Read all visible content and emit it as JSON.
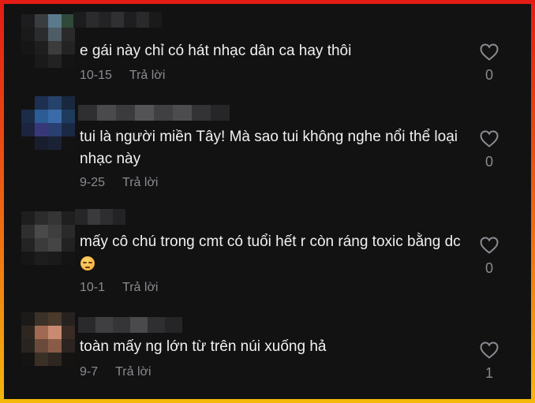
{
  "comments": [
    {
      "text": "e gái này chỉ có hát nhạc dân ca hay thôi",
      "date": "10-15",
      "reply_label": "Trả lời",
      "likes": "0",
      "avatar_colors": [
        "#1d1d1f",
        "#3a3d40",
        "#5a7a8c",
        "#2f4a3a",
        "#1a1a1a",
        "#2a2c2e",
        "#4e5c66",
        "#2a2a2a",
        "#161616",
        "#1e1e1e",
        "#3c3c3c",
        "#232323",
        "#121212",
        "#1a1a1a",
        "#222222",
        "#141414"
      ],
      "name_colors": [
        "#1c1c1e",
        "#2b2b2d",
        "#232325",
        "#303033",
        "#1e1e20",
        "#2a2a2c",
        "#1a1a1a"
      ]
    },
    {
      "text": "tui là người miền Tây! Mà sao tui không nghe nổi thể loại nhạc này",
      "date": "9-25",
      "reply_label": "Trả lời",
      "likes": "0",
      "avatar_colors": [
        "#121212",
        "#1e3050",
        "#25426a",
        "#18283e",
        "#1a2c48",
        "#2b5c94",
        "#3a6aa8",
        "#1e3a5c",
        "#1c2440",
        "#383878",
        "#2a3f70",
        "#1a2a44",
        "#121212",
        "#181e2e",
        "#1c2236",
        "#131313"
      ],
      "name_colors": [
        "#2f2f31",
        "#4a4a4d",
        "#3b3b3e",
        "#545457",
        "#404043",
        "#4c4c4f",
        "#333335",
        "#262628"
      ]
    },
    {
      "text": "mấy cô chú trong cmt có tuổi hết r còn ráng toxic bằng dc",
      "date": "10-1",
      "reply_label": "Trả lời",
      "likes": "0",
      "has_emoji": true,
      "avatar_colors": [
        "#1e1e1e",
        "#2c2c2c",
        "#353535",
        "#1f1f1f",
        "#2f2f2f",
        "#4a4a4a",
        "#3e3e3e",
        "#2a2a2a",
        "#242424",
        "#3b3b3b",
        "#454545",
        "#222222",
        "#161616",
        "#1d1d1d",
        "#1a1a1a",
        "#141414"
      ],
      "name_colors": [
        "#262628",
        "#3a3a3c",
        "#2e2e30",
        "#232325"
      ]
    },
    {
      "text": "toàn mấy ng lớn từ trên núi xuống hả",
      "date": "9-7",
      "reply_label": "Trả lời",
      "likes": "1",
      "avatar_colors": [
        "#1b1a18",
        "#3a3228",
        "#4a3a2c",
        "#262220",
        "#2e2620",
        "#a06a52",
        "#c98a72",
        "#3a2c24",
        "#2a2420",
        "#6a4a3a",
        "#8a5c48",
        "#2c2420",
        "#161412",
        "#3a3026",
        "#2e2720",
        "#141312"
      ],
      "name_colors": [
        "#2a2a2c",
        "#3f3f42",
        "#353538",
        "#4a4a4d",
        "#2f2f31",
        "#252527"
      ]
    }
  ],
  "colors": {
    "text": "#f1f1f2",
    "muted": "#8a8b91",
    "background": "#121212",
    "frame_top": "#e31b14",
    "frame_bottom": "#f5b90c"
  },
  "icons": {
    "like": "heart-outline-icon"
  }
}
